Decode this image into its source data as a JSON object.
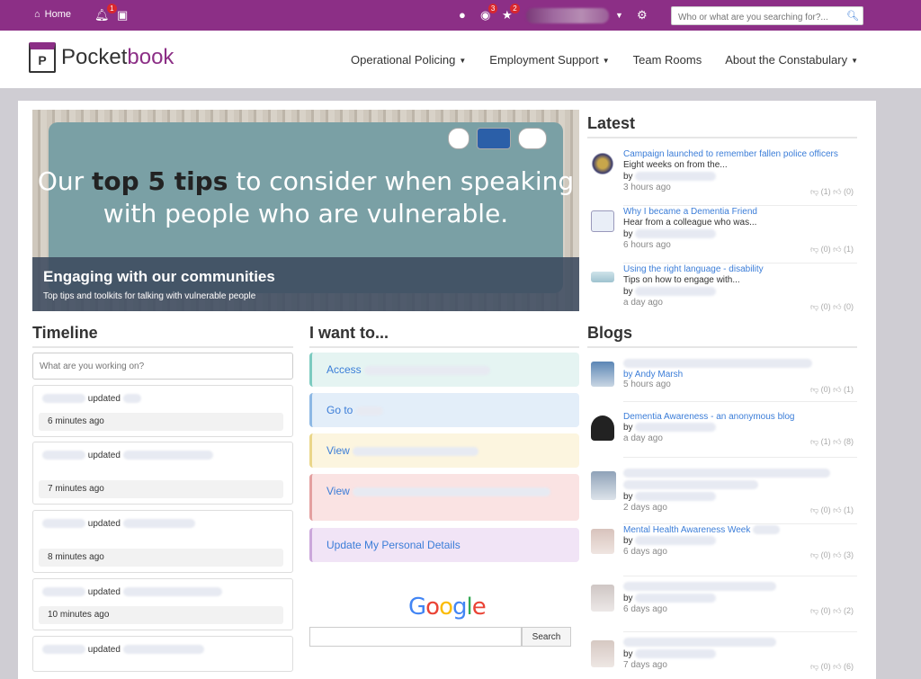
{
  "topbar": {
    "home_label": "Home",
    "notifications_count": "1",
    "watch_count": "3",
    "favourites_count": "2",
    "search_placeholder": "Who or what are you searching for?..."
  },
  "header": {
    "logo_text_plain": "Pocket",
    "logo_text_accent": "book",
    "logo_letter": "P",
    "nav": [
      "Operational Policing",
      "Employment Support",
      "Team Rooms",
      "About the Constabulary"
    ]
  },
  "hero": {
    "slogan_part1": "Our ",
    "slogan_bold": "top 5 tips",
    "slogan_part2": " to consider when speaking with people who are vulnerable.",
    "title": "Engaging with our communities",
    "subtitle": "Top tips and toolkits for talking with vulnerable people"
  },
  "latest": {
    "heading": "Latest",
    "items": [
      {
        "title": "Campaign launched to remember fallen police officers",
        "excerpt": "Eight weeks on from the...",
        "by": "by",
        "time": "3 hours ago",
        "likes": "(1)",
        "dislikes": "(0)"
      },
      {
        "title": "Why I became a Dementia Friend",
        "excerpt": "Hear from a colleague who was...",
        "by": "by",
        "time": "6 hours ago",
        "likes": "(0)",
        "dislikes": "(1)"
      },
      {
        "title": "Using the right language - disability",
        "excerpt": "Tips on how to engage with...",
        "by": "by",
        "time": "a day ago",
        "likes": "(0)",
        "dislikes": "(0)"
      }
    ]
  },
  "timeline": {
    "heading": "Timeline",
    "input_placeholder": "What are you working on?",
    "items": [
      {
        "action": "updated",
        "time": "6 minutes ago"
      },
      {
        "action": "updated",
        "time": "7 minutes ago"
      },
      {
        "action": "updated",
        "time": "8 minutes ago"
      },
      {
        "action": "updated",
        "time": "10 minutes ago"
      },
      {
        "action": "updated",
        "time": ""
      }
    ]
  },
  "iwant": {
    "heading": "I want to...",
    "links": [
      "Access",
      "Go to",
      "View",
      "View",
      "Update My Personal Details"
    ],
    "google_letters": [
      "G",
      "o",
      "o",
      "g",
      "l",
      "e"
    ],
    "search_button": "Search"
  },
  "blogs": {
    "heading": "Blogs",
    "items": [
      {
        "title": "",
        "by": "by Andy Marsh",
        "time": "5 hours ago",
        "likes": "(0)",
        "dislikes": "(1)"
      },
      {
        "title": "Dementia Awareness - an anonymous blog",
        "by": "by",
        "time": "a day ago",
        "likes": "(1)",
        "dislikes": "(8)"
      },
      {
        "title": "",
        "by": "by",
        "time": "2 days ago",
        "likes": "(0)",
        "dislikes": "(1)"
      },
      {
        "title": "Mental Health Awareness Week",
        "by": "by",
        "time": "6 days ago",
        "likes": "(0)",
        "dislikes": "(3)"
      },
      {
        "title": "",
        "by": "by",
        "time": "6 days ago",
        "likes": "(0)",
        "dislikes": "(2)"
      },
      {
        "title": "",
        "by": "by",
        "time": "7 days ago",
        "likes": "(0)",
        "dislikes": "(6)"
      }
    ]
  },
  "colors": {
    "brand": "#8c2f86",
    "link": "#3b7dd8"
  }
}
